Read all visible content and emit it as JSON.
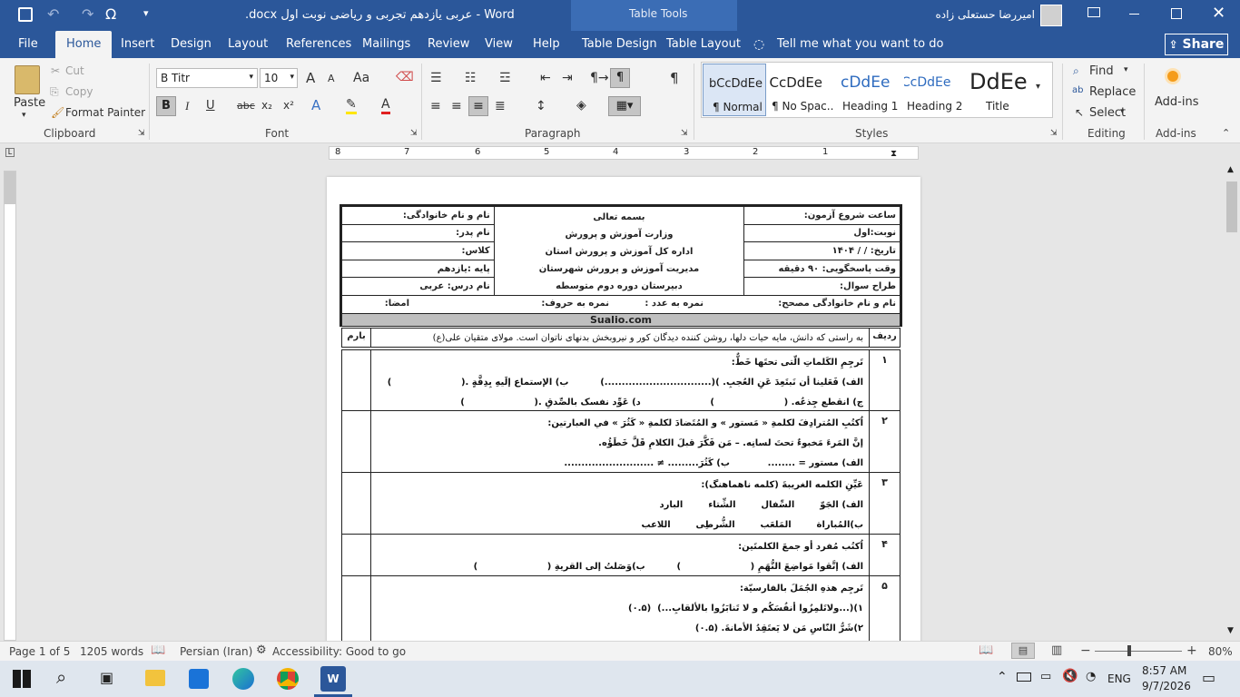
{
  "titlebar": {
    "doc_title": ".docx عربی یازدهم تجربی و ریاضی نوبت اول - Word",
    "context_title": "Table Tools",
    "user_name": "امیررضا حستعلی زاده",
    "qat": {
      "save": "save-icon",
      "undo": "undo-icon",
      "redo": "redo-icon",
      "symbol": "Ω"
    }
  },
  "tabs": [
    {
      "label": "File"
    },
    {
      "label": "Home"
    },
    {
      "label": "Insert"
    },
    {
      "label": "Design"
    },
    {
      "label": "Layout"
    },
    {
      "label": "References"
    },
    {
      "label": "Mailings"
    },
    {
      "label": "Review"
    },
    {
      "label": "View"
    },
    {
      "label": "Help"
    },
    {
      "label": "Table Design"
    },
    {
      "label": "Table Layout"
    }
  ],
  "tellme": "Tell me what you want to do",
  "share_label": "Share",
  "ribbon": {
    "clipboard": {
      "paste": "Paste",
      "cut": "Cut",
      "copy": "Copy",
      "format_painter": "Format Painter",
      "label": "Clipboard"
    },
    "font": {
      "name": "B Titr",
      "size": "10",
      "label": "Font",
      "bold": "B",
      "italic": "I",
      "underline": "U",
      "strike": "abc",
      "sub": "x₂",
      "sup": "x²",
      "grow": "A",
      "shrink": "A",
      "case": "Aa"
    },
    "paragraph": {
      "label": "Paragraph",
      "pilcrow": "¶"
    },
    "styles": {
      "label": "Styles",
      "items": [
        {
          "preview": "bCcDdEe",
          "name": "¶ Normal"
        },
        {
          "preview": "bCcDdEe",
          "name": "¶ No Spac..."
        },
        {
          "preview": "cDdEe",
          "name": "Heading 1"
        },
        {
          "preview": "bCcDdEe",
          "name": "Heading 2"
        },
        {
          "preview": "DdEe",
          "name": "Title"
        }
      ]
    },
    "editing": {
      "find": "Find",
      "replace": "Replace",
      "select": "Select",
      "label": "Editing"
    },
    "addins": {
      "button": "Add-ins",
      "label": "Add-ins"
    }
  },
  "ruler": {
    "numbers": [
      "8",
      "7",
      "6",
      "5",
      "4",
      "3",
      "2",
      "1"
    ]
  },
  "doc": {
    "header": {
      "r1": {
        "right": "نام و نام خانوادگی:",
        "center": "بسمه تعالی",
        "left": "ساعت شروع آزمون:"
      },
      "r2": {
        "right": "نام پدر:",
        "center": "وزارت آموزش و پرورش",
        "left": "نوبت:اول"
      },
      "r3": {
        "right": "کلاس:",
        "center": "اداره کل آموزش و پرورش استان",
        "left": "تاریخ:   /   /  ۱۴۰۴"
      },
      "r4": {
        "right": "پایه :یازدهم",
        "center": "مدیریت آموزش و پرورش شهرستان",
        "left": "وقت پاسخگویی: ۹۰ دقیقه"
      },
      "r5": {
        "right": "نام درس: عربی",
        "center": "دبیرستان دوره دوم متوسطه",
        "left": "طراح سوال:"
      },
      "r6": {
        "right": "نام و نام خانوادگی مصحح:",
        "c1": "نمره به عدد :",
        "c2": "نمره به حروف:",
        "left": "امضا:"
      }
    },
    "banner": "Sualio.com",
    "intro": {
      "num": "ردیف",
      "text": "به راستی که دانش، مایه حیات دلها، روشن کننده دیدگان کور و نیروبخش بدنهای ناتوان است. مولای متقیان علی(ع)",
      "score": "بارم"
    },
    "questions": [
      {
        "num": "۱",
        "lines": [
          "تَرجِمِ الکَلماتِ الّتی تحتَها خَطٌّ:",
          "الف) فَعَلینا أن نَبتَعِدَ عَنِ العُجبِ. )(...............................)          ب) الإستماع إلَیهِ بِدِقَّةٍ .(                      )",
          "ج) انقطع جِذعُه. (                      )                      د) عَوِّد نفسک بالصِّدقِ .(                      )"
        ]
      },
      {
        "num": "۲",
        "lines": [
          "اُکتُبِ المُترادِفَ لکلمةِ « مَستور » و المُتَضادَ لکلمةِ « کَثُرَ » في العبارتین:",
          "إنَّ المَرءَ مَخبوءٌ تحتَ لسانِه. – مَن فَکَّرَ قبلَ الکلامِ قَلَّ خَطَؤُه.",
          "الف) مستور = ........            ب) کَثُرَ......... ≠ .........................."
        ]
      },
      {
        "num": "۳",
        "lines": [
          "عَیِّنِ الکلمه الغریبةَ (کلمه ناهماهنگ):",
          "الف) الجَوّ        السِّفال        الشِّتاء        البارد",
          "ب)المُباراة        المَلعَب        الشُّرطِی        اللاعب"
        ]
      },
      {
        "num": "۴",
        "lines": [
          "اُکتُب مُفرد أو جمعَ الکلمتَین:",
          "الف) إتَّقوا مَواضِعَ التُّهَمِ (                      )          ب)وَصَلتُ إلی القریةِ (                      )"
        ]
      },
      {
        "num": "۵",
        "lines": [
          "تَرجِم هذهِ الجُمَلَ بالفارسیّة:",
          "۱)(...ولاتَلمِزُوا أنفُسَکُم و لا تَنابَزُوا بالألقابِ...)  (۰.۵)",
          "۲)شَرُّ النّاسِ مَن لا یَعتَقِدُ الأمانةَ. (۰.۵)"
        ]
      }
    ]
  },
  "status": {
    "page": "Page 1 of 5",
    "words": "1205 words",
    "lang": "Persian (Iran)",
    "access": "Accessibility: Good to go",
    "zoom": "80%"
  },
  "taskbar": {
    "lang": "ENG",
    "time": "8:57 AM",
    "date": "9/7/2026"
  }
}
